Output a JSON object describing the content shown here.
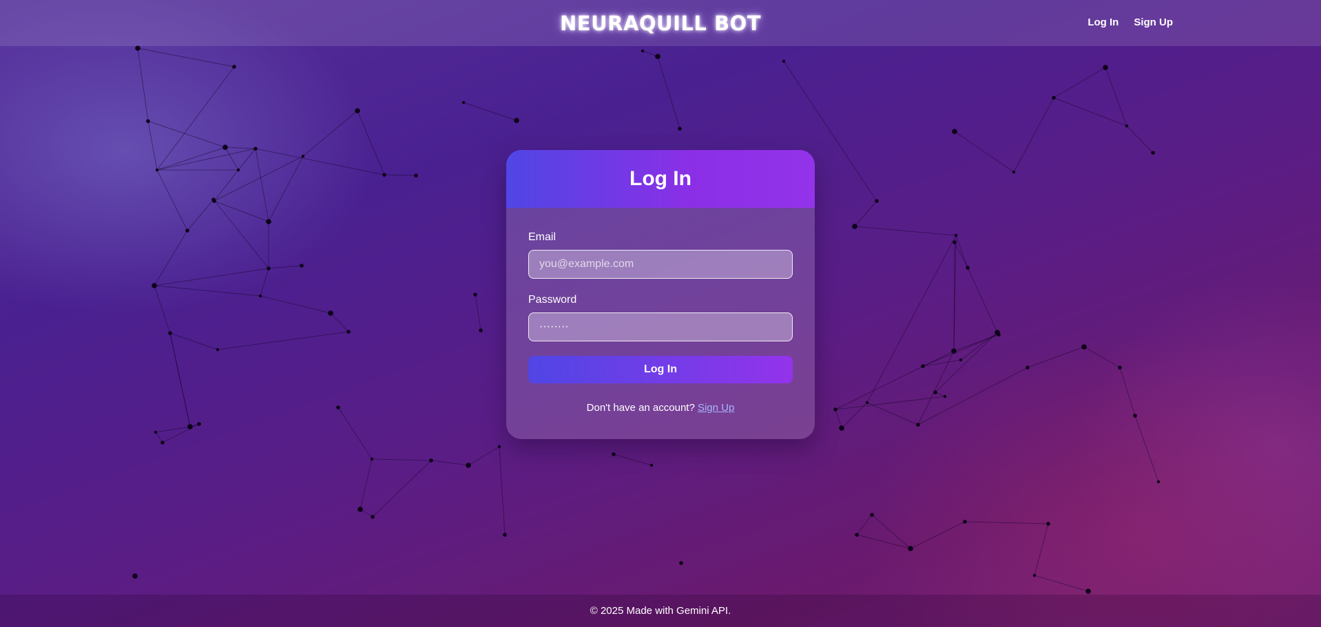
{
  "header": {
    "brand": "NEURAQUILL BOT",
    "nav": [
      {
        "label": "Log In"
      },
      {
        "label": "Sign Up"
      }
    ]
  },
  "login_card": {
    "title": "Log In",
    "email_label": "Email",
    "email_placeholder": "you@example.com",
    "email_value": "",
    "password_label": "Password",
    "password_value": "········",
    "submit_label": "Log In",
    "switch_text": "Don't have an account?",
    "switch_link": "Sign Up"
  },
  "footer": {
    "text": "© 2025 Made with Gemini API."
  },
  "colors": {
    "accent_start": "#5046e5",
    "accent_end": "#9333ea",
    "link": "#a9b4ff"
  }
}
